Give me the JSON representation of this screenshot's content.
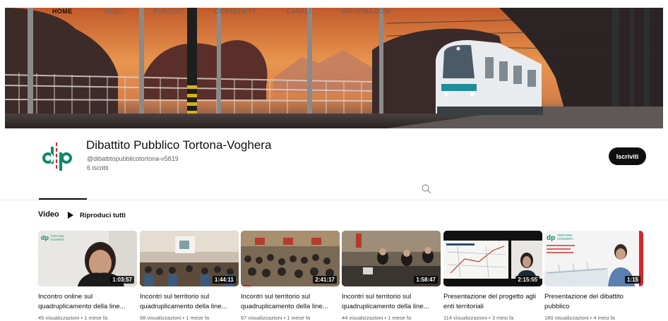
{
  "channel": {
    "name": "Dibattito Pubblico Tortona-Voghera",
    "handle": "@dibattitopubblicotortona-v5819",
    "subscribers": "6 iscritti",
    "subscribe_label": "Iscriviti",
    "brand_colors": {
      "green": "#0b8a6a",
      "red": "#d22727"
    },
    "avatar_letters": "dp"
  },
  "tabs": [
    {
      "label": "HOME",
      "active": true
    },
    {
      "label": "VIDEO",
      "active": false
    },
    {
      "label": "PLAYLIST",
      "active": false
    },
    {
      "label": "COMMUNITY",
      "active": false
    },
    {
      "label": "CANALI",
      "active": false
    },
    {
      "label": "INFORMAZIONI",
      "active": false
    }
  ],
  "section": {
    "title": "Video",
    "play_all_label": "Riproduci tutti"
  },
  "videos": [
    {
      "title": "Incontro online sul quadruplicamento della line...",
      "views": "45 visualizzazioni",
      "age": "1 mese fa",
      "duration": "1:03:57",
      "watched_fraction": 0.0
    },
    {
      "title": "Incontri sul territorio sul quadruplicamento della line...",
      "views": "68 visualizzazioni",
      "age": "1 mese fa",
      "duration": "1:44:11",
      "watched_fraction": 0.0
    },
    {
      "title": "Incontri sul territorio sul quadruplicamento della line...",
      "views": "67 visualizzazioni",
      "age": "1 mese fa",
      "duration": "2:41:17",
      "watched_fraction": 0.1
    },
    {
      "title": "Incontri sul territorio sul quadruplicamento della line...",
      "views": "44 visualizzazioni",
      "age": "1 mese fa",
      "duration": "1:58:47",
      "watched_fraction": 0.0
    },
    {
      "title": "Presentazione del progetto agli enti territoriali",
      "views": "114 visualizzazioni",
      "age": "3 mesi fa",
      "duration": "2:15:55",
      "watched_fraction": 0.0
    },
    {
      "title": "Presentazione del dibattito pubblico",
      "views": "180 visualizzazioni",
      "age": "4 mesi fa",
      "duration": "1:15",
      "watched_fraction": 0.0
    }
  ],
  "thumb_brand": {
    "tortona": "TORTONA",
    "voghera": "VOGHERA"
  },
  "meta_separator": "•",
  "icons": [
    "search-icon",
    "play-icon"
  ]
}
